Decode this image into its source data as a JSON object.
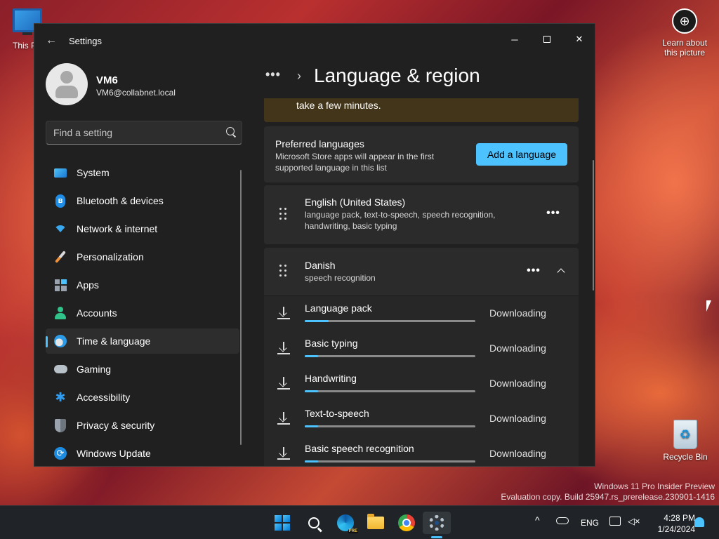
{
  "desktop": {
    "this_pc_label": "This PC",
    "learn_label": "Learn about this picture",
    "recycle_label": "Recycle Bin",
    "watermark_line1": "Windows 11 Pro Insider Preview",
    "watermark_line2": "Evaluation copy. Build 25947.rs_prerelease.230901-1416"
  },
  "window": {
    "title": "Settings",
    "minimize_glyph": "─",
    "close_glyph": "✕",
    "back_glyph": "←"
  },
  "user": {
    "name": "VM6",
    "email": "VM6@collabnet.local"
  },
  "search": {
    "placeholder": "Find a setting"
  },
  "nav": {
    "items": [
      {
        "label": "System",
        "icon": "system-icon"
      },
      {
        "label": "Bluetooth & devices",
        "icon": "bluetooth-icon"
      },
      {
        "label": "Network & internet",
        "icon": "wifi-icon"
      },
      {
        "label": "Personalization",
        "icon": "brush-icon"
      },
      {
        "label": "Apps",
        "icon": "apps-icon"
      },
      {
        "label": "Accounts",
        "icon": "accounts-icon"
      },
      {
        "label": "Time & language",
        "icon": "time-language-icon",
        "active": true
      },
      {
        "label": "Gaming",
        "icon": "gaming-icon"
      },
      {
        "label": "Accessibility",
        "icon": "accessibility-icon"
      },
      {
        "label": "Privacy & security",
        "icon": "shield-icon"
      },
      {
        "label": "Windows Update",
        "icon": "update-icon"
      }
    ]
  },
  "content": {
    "breadcrumb_more": "•••",
    "breadcrumb_sep": "›",
    "title": "Language & region",
    "notice_text": "take a few minutes.",
    "preferred": {
      "title": "Preferred languages",
      "description": "Microsoft Store apps will appear in the first supported language in this list",
      "add_button": "Add a language"
    },
    "languages": [
      {
        "name": "English (United States)",
        "description": "language pack, text-to-speech, speech recognition, handwriting, basic typing",
        "more": "•••"
      },
      {
        "name": "Danish",
        "description": "speech recognition",
        "more": "•••"
      }
    ],
    "features": [
      {
        "name": "Language pack",
        "status": "Downloading",
        "progress": 0.14
      },
      {
        "name": "Basic typing",
        "status": "Downloading",
        "progress": 0.08
      },
      {
        "name": "Handwriting",
        "status": "Downloading",
        "progress": 0.08
      },
      {
        "name": "Text-to-speech",
        "status": "Downloading",
        "progress": 0.08
      },
      {
        "name": "Basic speech recognition",
        "status": "Downloading",
        "progress": 0.08
      }
    ]
  },
  "taskbar": {
    "pinned": [
      "start-icon",
      "search-icon",
      "edge-icon",
      "file-explorer-icon",
      "chrome-icon",
      "settings-icon"
    ],
    "edge_badge": "PRE",
    "chevron": "^",
    "language": "ENG",
    "time": "4:28 PM",
    "date": "1/24/2024"
  },
  "colors": {
    "accent": "#4cc2ff",
    "window_bg": "#202020",
    "card_bg": "#2b2b2b",
    "notice_bg": "#433519"
  }
}
